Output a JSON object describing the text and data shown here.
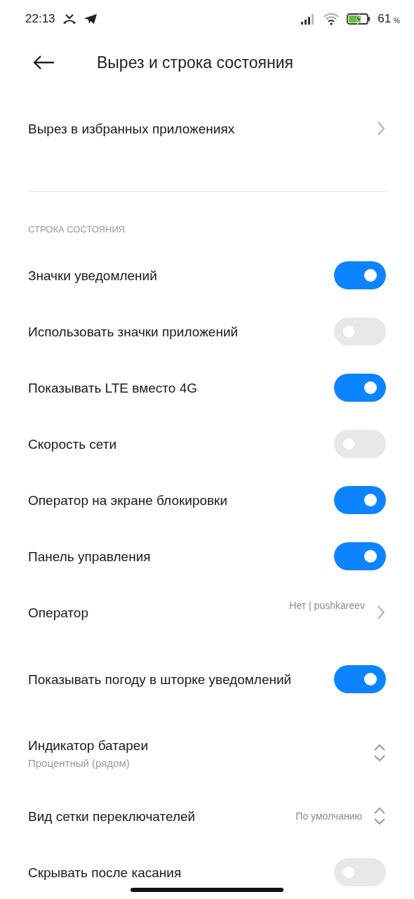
{
  "status_bar": {
    "time": "22:13",
    "battery_percent": "61",
    "percent_sign": "%"
  },
  "header": {
    "title": "Вырез и строка состояния"
  },
  "top_item": {
    "label": "Вырез в избранных приложениях"
  },
  "section": {
    "title": "СТРОКА СОСТОЯНИЯ"
  },
  "items": [
    {
      "kind": "toggle",
      "label": "Значки уведомлений",
      "on": true
    },
    {
      "kind": "toggle",
      "label": "Использовать значки приложений",
      "on": false
    },
    {
      "kind": "toggle",
      "label": "Показывать LTE вместо 4G",
      "on": true
    },
    {
      "kind": "toggle",
      "label": "Скорость сети",
      "on": false
    },
    {
      "kind": "toggle",
      "label": "Оператор на экране блокировки",
      "on": true
    },
    {
      "kind": "toggle",
      "label": "Панель управления",
      "on": true
    },
    {
      "kind": "link",
      "label": "Оператор",
      "value": "Нет | pushkareev"
    },
    {
      "kind": "toggle",
      "label": "Показывать погоду в шторке уведомлений",
      "on": true
    },
    {
      "kind": "select",
      "label": "Индикатор батареи",
      "subtitle": "Процентный (рядом)"
    },
    {
      "kind": "select",
      "label": "Вид сетки переключателей",
      "value": "По умолчанию"
    },
    {
      "kind": "toggle",
      "label": "Скрывать после касания",
      "on": false
    }
  ]
}
